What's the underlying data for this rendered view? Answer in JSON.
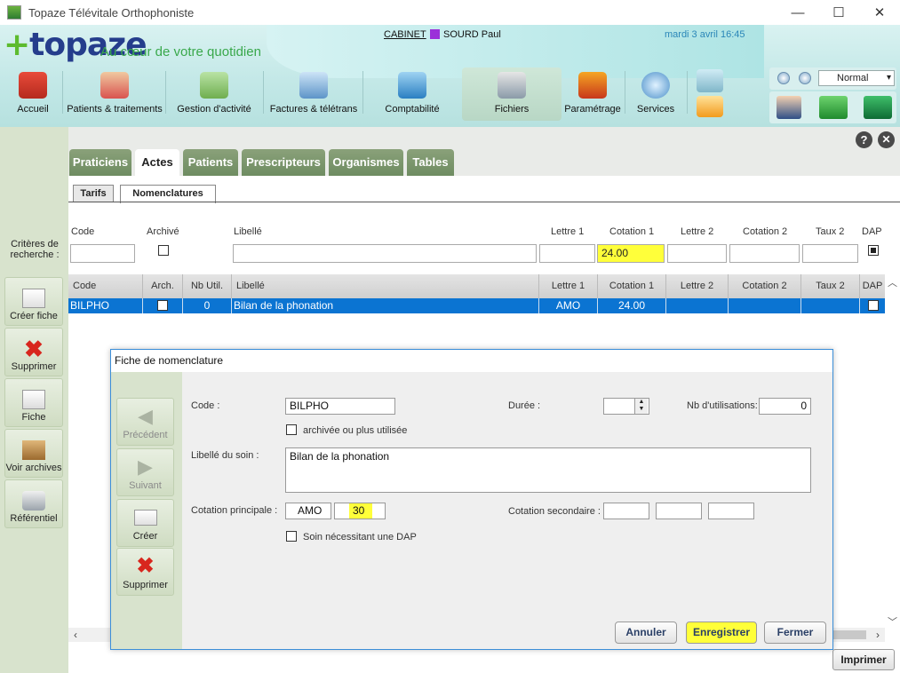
{
  "window": {
    "title": "Topaze Télévitale Orthophoniste",
    "minimize": "—",
    "maximize": "☐",
    "close": "✕"
  },
  "header": {
    "logo": "topaze",
    "tagline": "Au cœur de votre quotidien",
    "cabinet": "CABINET",
    "user_name": "SOURD Paul",
    "user_color": "#9b30d9",
    "datetime": "mardi 3 avril 16:45",
    "zoom_value": "Normal",
    "nav": [
      {
        "label": "Accueil",
        "icon": "house-icon"
      },
      {
        "label": "Patients & traitements",
        "icon": "patients-icon"
      },
      {
        "label": "Gestion d'activité",
        "icon": "folder-icon"
      },
      {
        "label": "Factures & télétrans",
        "icon": "invoices-icon"
      },
      {
        "label": "Comptabilité",
        "icon": "calculator-icon"
      },
      {
        "label": "Fichiers",
        "icon": "database-icon",
        "active": true
      },
      {
        "label": "Paramétrage",
        "icon": "gears-icon"
      },
      {
        "label": "Services",
        "icon": "globe-icon"
      }
    ],
    "help": "?",
    "close_app": "✕"
  },
  "sidebar": {
    "criteria_label": "Critères de recherche :",
    "buttons": [
      {
        "label": "Créer fiche",
        "icon": "new-sheet-icon"
      },
      {
        "label": "Supprimer",
        "icon": "delete-x-icon"
      },
      {
        "label": "Fiche",
        "icon": "sheet-icon"
      },
      {
        "label": "Voir archives",
        "icon": "archive-box-icon"
      },
      {
        "label": "Référentiel",
        "icon": "reference-db-icon"
      }
    ]
  },
  "tabs": [
    "Praticiens",
    "Actes",
    "Patients",
    "Prescripteurs",
    "Organismes",
    "Tables"
  ],
  "subtabs": [
    "Tarifs",
    "Nomenclatures"
  ],
  "criteria": {
    "labels": [
      "Code",
      "Archivé",
      "Libellé",
      "Lettre 1",
      "Cotation 1",
      "Lettre 2",
      "Cotation 2",
      "Taux 2",
      "DAP"
    ],
    "cotation1_value": "24.00"
  },
  "table": {
    "headers": [
      "Code",
      "Arch.",
      "Nb Util.",
      "Libellé",
      "Lettre 1",
      "Cotation 1",
      "Lettre 2",
      "Cotation 2",
      "Taux 2",
      "DAP"
    ],
    "rows": [
      {
        "code": "BILPHO",
        "nb_util": "0",
        "libelle": "Bilan de la phonation",
        "lettre1": "AMO",
        "cotation1": "24.00",
        "lettre2": "",
        "cotation2": "",
        "taux2": ""
      }
    ]
  },
  "modal": {
    "title": "Fiche de nomenclature",
    "side_buttons": [
      {
        "label": "Précédent",
        "icon": "arrow-left-icon",
        "disabled": true
      },
      {
        "label": "Suivant",
        "icon": "arrow-right-icon",
        "disabled": true
      },
      {
        "label": "Créer",
        "icon": "new-sheet-icon",
        "disabled": false
      },
      {
        "label": "Supprimer",
        "icon": "delete-x-icon",
        "disabled": false
      }
    ],
    "code_label": "Code :",
    "code_value": "BILPHO",
    "duree_label": "Durée :",
    "duree_value": "",
    "nb_util_label": "Nb d'utilisations:",
    "nb_util_value": "0",
    "archived_label": "archivée ou plus utilisée",
    "libelle_label": "Libellé du soin :",
    "libelle_value": "Bilan de la phonation",
    "cot_principale_label": "Cotation principale :",
    "cot_principale_lettre": "AMO",
    "cot_principale_value": "30",
    "cot_secondaire_label": "Cotation secondaire :",
    "dap_label": "Soin nécessitant une DAP",
    "buttons": {
      "cancel": "Annuler",
      "save": "Enregistrer",
      "close": "Fermer"
    }
  },
  "print_label": "Imprimer",
  "colors": {
    "selection": "#0b74d2",
    "highlight": "#ffff3a",
    "tab_green": "#7a9669",
    "brand_blue": "#253d8c",
    "brand_green": "#5dbb2f"
  }
}
